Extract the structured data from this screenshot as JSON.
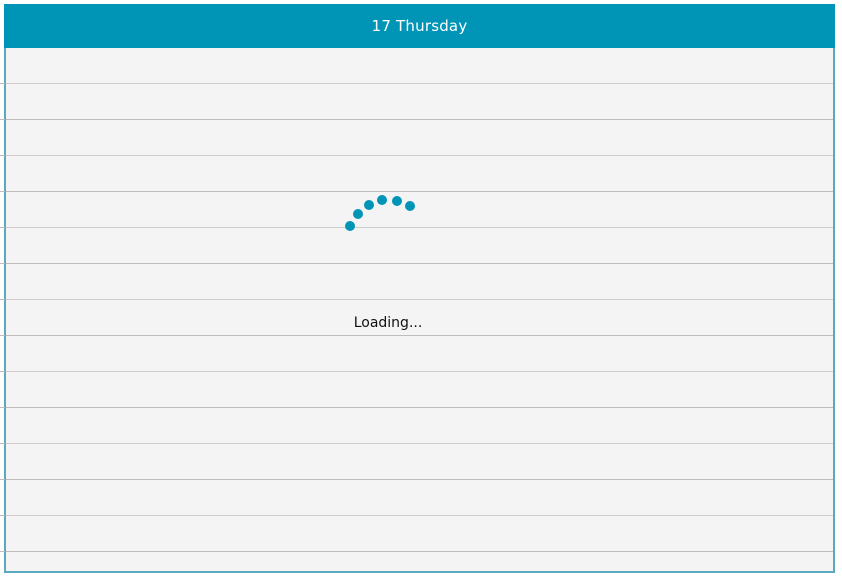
{
  "header": {
    "day_label": "17 Thursday"
  },
  "loading": {
    "text": "Loading..."
  },
  "colors": {
    "accent": "#0095b6",
    "border": "#5aa9c0",
    "background": "#f4f4f4"
  },
  "icons": {
    "spinner": "loading-spinner-icon"
  }
}
